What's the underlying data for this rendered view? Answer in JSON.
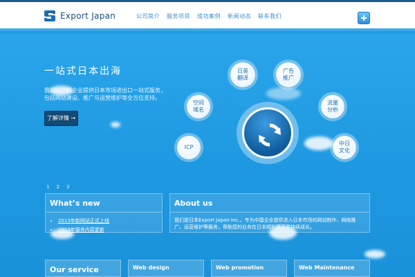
{
  "header": {
    "logo_text": "Export Japan",
    "nav": [
      "公司简介",
      "服务项目",
      "成功案例",
      "新闻动态",
      "联系我们"
    ]
  },
  "hero": {
    "title": "一站式日本出海",
    "description": "我们为中国企业提供日本市场进出口一站式服务，包括网站建设、推广与运营维护等全方位支持。",
    "button_label": "了解详情 →",
    "bubbles": [
      "日英\n翻译",
      "广告\n推广",
      "空间\n域名",
      "流量\n分析",
      "ICP",
      "中日\n文化"
    ],
    "pager": [
      "1",
      "2",
      "3"
    ]
  },
  "news": {
    "title": "What’s new",
    "items": [
      "2013年新网站正式上线",
      "2013年服务内容更新"
    ]
  },
  "about": {
    "title": "About us",
    "text": "我们是日本Export Japan Inc.，专为中国企业提供进入日本市场的网站制作、网络推广、运营维护等服务，帮助您的业务在日本顺利展开并持续成长。"
  },
  "services": {
    "title": "Our service",
    "items": [
      "Web design",
      "Web promotion",
      "Web Maintenance"
    ]
  },
  "colors": {
    "brand": "#1a4f80",
    "sky": "#1e9be3",
    "button": "#134a74"
  }
}
